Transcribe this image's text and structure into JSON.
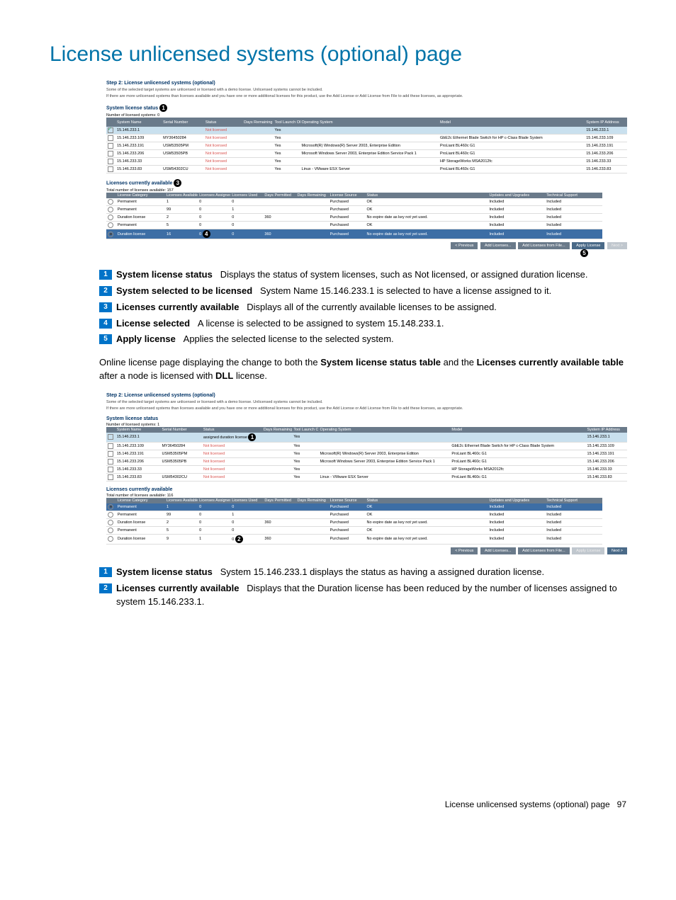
{
  "page": {
    "title": "License unlicensed systems (optional) page"
  },
  "shot1": {
    "step_title": "Step 2: License unlicensed systems (optional)",
    "line1": "Some of the selected target systems are unlicensed or licensed with a demo license. Unlicensed systems cannot be included.",
    "line2": "If there are more unlicensed systems than licenses available and you have one or more additional licenses for this product, use the Add License or Add License from File to add these licenses, as appropriate.",
    "sys_section": "System license status",
    "sys_count_label": "Number of licensed systems:",
    "sys_count": "0",
    "sys_headers": [
      "",
      "System Name",
      "Serial Number",
      "Status",
      "Days Remaining",
      "Tool Launch OK",
      "Operating System",
      "Model",
      "System IP Address"
    ],
    "sys_rows": [
      {
        "sel": true,
        "hl": true,
        "name": "15.146.233.1",
        "serial": "",
        "status": "Not licensed",
        "days": "",
        "ok": "Yes",
        "os": "",
        "model": "",
        "ip": "15.146.233.1"
      },
      {
        "sel": false,
        "name": "15.146.233.109",
        "serial": "MY36450284",
        "status": "Not licensed",
        "days": "",
        "ok": "Yes",
        "os": "",
        "model": "GbE2c Ethernet Blade Switch for HP c-Class Blade System",
        "ip": "15.146.233.109"
      },
      {
        "sel": false,
        "name": "15.146.233.191",
        "serial": "USM53505PM",
        "status": "Not licensed",
        "days": "",
        "ok": "Yes",
        "os": "Microsoft(R) Windows(R) Server 2003, Enterprise Edition",
        "model": "ProLiant BL460c G1",
        "ip": "15.146.233.191"
      },
      {
        "sel": false,
        "name": "15.146.233.206",
        "serial": "USM53505PB",
        "status": "Not licensed",
        "days": "",
        "ok": "Yes",
        "os": "Microsoft Windows Server 2003, Enterprise Edition Service Pack 1",
        "model": "ProLiant BL460c G1",
        "ip": "15.146.233.206"
      },
      {
        "sel": false,
        "name": "15.146.233.33",
        "serial": "",
        "status": "Not licensed",
        "days": "",
        "ok": "Yes",
        "os": "",
        "model": "HP StorageWorks MSA2012fc",
        "ip": "15.146.233.33"
      },
      {
        "sel": false,
        "name": "15.146.233.83",
        "serial": "USM54302CU",
        "status": "Not licensed",
        "days": "",
        "ok": "Yes",
        "os": "Linux - VMware ESX Server",
        "model": "ProLiant BL460c G1",
        "ip": "15.146.233.83"
      }
    ],
    "lic_section": "Licenses currently available",
    "lic_count_label": "Total number of licenses available:",
    "lic_count": "157",
    "lic_headers": [
      "",
      "License Category",
      "Licenses Available",
      "Licenses Assigned",
      "Licenses Used",
      "Days Permitted",
      "Days Remaining",
      "License Source",
      "Status",
      "Updates and Upgrades",
      "Technical Support"
    ],
    "lic_rows": [
      {
        "on": false,
        "cat": "Permanent",
        "avail": "1",
        "assigned": "0",
        "used": "0",
        "perm": "",
        "rem": "",
        "src": "Purchased",
        "status": "OK",
        "upd": "Included",
        "sup": "Included"
      },
      {
        "on": false,
        "cat": "Permanent",
        "avail": "99",
        "assigned": "0",
        "used": "1",
        "perm": "",
        "rem": "",
        "src": "Purchased",
        "status": "OK",
        "upd": "Included",
        "sup": "Included"
      },
      {
        "on": false,
        "cat": "Duration license",
        "avail": "2",
        "assigned": "0",
        "used": "0",
        "perm": "360",
        "rem": "",
        "src": "Purchased",
        "status": "No expire date as key not yet used.",
        "upd": "Included",
        "sup": "Included"
      },
      {
        "on": false,
        "cat": "Permanent",
        "avail": "5",
        "assigned": "0",
        "used": "0",
        "perm": "",
        "rem": "",
        "src": "Purchased",
        "status": "OK",
        "upd": "Included",
        "sup": "Included"
      },
      {
        "on": true,
        "sel": true,
        "cat": "Duration license",
        "avail": "16",
        "assigned": "0",
        "used": "0",
        "perm": "360",
        "rem": "",
        "src": "Purchased",
        "status": "No expire date as key not yet used.",
        "upd": "Included",
        "sup": "Included"
      }
    ],
    "buttons": {
      "prev": "< Previous",
      "add": "Add Licenses...",
      "addfile": "Add Licenses from File...",
      "apply": "Apply License",
      "next": "Next >"
    }
  },
  "legend1": [
    {
      "n": "1",
      "bold": "System license status",
      "text": "Displays the status of system licenses, such as Not licensed, or assigned duration license."
    },
    {
      "n": "2",
      "bold": "System selected to be licensed",
      "text": "System Name 15.146.233.1 is selected to have a license assigned to it."
    },
    {
      "n": "3",
      "bold": "Licenses currently available",
      "text": "Displays all of the currently available licenses to be assigned."
    },
    {
      "n": "4",
      "bold": "License selected",
      "text": "A license is selected to be assigned to system 15.148.233.1."
    },
    {
      "n": "5",
      "bold": "Apply license",
      "text": "Applies the selected license to the selected system."
    }
  ],
  "body_para": {
    "pre": "Online license page displaying the change to both the ",
    "b1": "System license status table",
    "mid": " and the ",
    "b2": "Licenses currently available table",
    "post": " after a node is licensed with ",
    "b3": "DLL",
    "tail": " license."
  },
  "shot2": {
    "step_title": "Step 2: License unlicensed systems (optional)",
    "line1": "Some of the selected target systems are unlicensed or licensed with a demo license. Unlicensed systems cannot be included.",
    "line2": "If there are more unlicensed systems than licenses available and you have one or more additional licenses for this product, use the Add License or Add License from File to add these licenses, as appropriate.",
    "sys_section": "System license status",
    "sys_count_label": "Number of licensed systems:",
    "sys_count": "1",
    "sys_rows": [
      {
        "sel": false,
        "hl": true,
        "name": "15.146.233.1",
        "serial": "",
        "status": "assigned duration license",
        "status_red": false,
        "days": "",
        "ok": "Yes",
        "os": "",
        "model": "",
        "ip": "15.146.233.1"
      },
      {
        "sel": false,
        "name": "15.146.233.109",
        "serial": "MY36450284",
        "status": "Not licensed",
        "status_red": true,
        "days": "",
        "ok": "Yes",
        "os": "",
        "model": "GbE2c Ethernet Blade Switch for HP c-Class Blade System",
        "ip": "15.146.233.109"
      },
      {
        "sel": false,
        "name": "15.146.233.191",
        "serial": "USM53505PM",
        "status": "Not licensed",
        "status_red": true,
        "days": "",
        "ok": "Yes",
        "os": "Microsoft(R) Windows(R) Server 2003, Enterprise Edition",
        "model": "ProLiant BL460c G1",
        "ip": "15.146.233.191"
      },
      {
        "sel": false,
        "name": "15.146.233.206",
        "serial": "USM53505PB",
        "status": "Not licensed",
        "status_red": true,
        "days": "",
        "ok": "Yes",
        "os": "Microsoft Windows Server 2003, Enterprise Edition Service Pack 1",
        "model": "ProLiant BL460c G1",
        "ip": "15.146.233.206"
      },
      {
        "sel": false,
        "name": "15.146.233.33",
        "serial": "",
        "status": "Not licensed",
        "status_red": true,
        "days": "",
        "ok": "Yes",
        "os": "",
        "model": "HP StorageWorks MSA2012fc",
        "ip": "15.146.233.33"
      },
      {
        "sel": false,
        "name": "15.146.233.83",
        "serial": "USM54302CU",
        "status": "Not licensed",
        "status_red": true,
        "days": "",
        "ok": "Yes",
        "os": "Linux - VMware ESX Server",
        "model": "ProLiant BL460c G1",
        "ip": "15.146.233.83"
      }
    ],
    "lic_section": "Licenses currently available",
    "lic_count_label": "Total number of licenses available:",
    "lic_count": "116",
    "lic_rows": [
      {
        "on": true,
        "sel": true,
        "cat": "Permanent",
        "avail": "1",
        "assigned": "0",
        "used": "0",
        "perm": "",
        "rem": "",
        "src": "Purchased",
        "status": "OK",
        "upd": "Included",
        "sup": "Included"
      },
      {
        "on": false,
        "cat": "Permanent",
        "avail": "99",
        "assigned": "0",
        "used": "1",
        "perm": "",
        "rem": "",
        "src": "Purchased",
        "status": "OK",
        "upd": "Included",
        "sup": "Included"
      },
      {
        "on": false,
        "cat": "Duration license",
        "avail": "2",
        "assigned": "0",
        "used": "0",
        "perm": "360",
        "rem": "",
        "src": "Purchased",
        "status": "No expire date as key not yet used.",
        "upd": "Included",
        "sup": "Included"
      },
      {
        "on": false,
        "cat": "Permanent",
        "avail": "5",
        "assigned": "0",
        "used": "0",
        "perm": "",
        "rem": "",
        "src": "Purchased",
        "status": "OK",
        "upd": "Included",
        "sup": "Included"
      },
      {
        "on": false,
        "cat": "Duration license",
        "avail": "9",
        "assigned": "1",
        "used": "0",
        "perm": "360",
        "rem": "",
        "src": "Purchased",
        "status": "No expire date as key not yet used.",
        "upd": "Included",
        "sup": "Included"
      }
    ],
    "buttons": {
      "prev": "< Previous",
      "add": "Add Licenses...",
      "addfile": "Add Licenses from File...",
      "apply": "Apply License",
      "next": "Next >"
    }
  },
  "legend2": [
    {
      "n": "1",
      "bold": "System license status",
      "text": "System 15.146.233.1 displays the status as having a assigned duration license."
    },
    {
      "n": "2",
      "bold": "Licenses currently available",
      "text": "Displays that the Duration license has been reduced by the number of licenses assigned to system 15.146.233.1."
    }
  ],
  "footer": {
    "text": "License unlicensed systems (optional) page",
    "page": "97"
  }
}
